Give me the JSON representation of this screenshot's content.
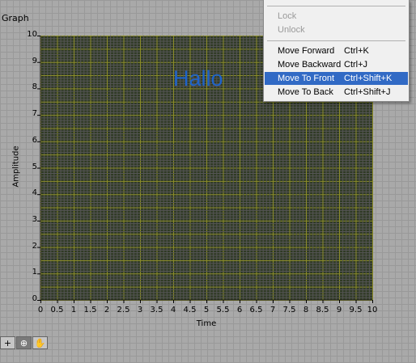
{
  "graph": {
    "title": "Graph",
    "ylabel": "Amplitude",
    "xlabel": "Time",
    "annotation": "Hallo",
    "y_ticks": [
      "10",
      "9",
      "8",
      "7",
      "6",
      "5",
      "4",
      "3",
      "2",
      "1",
      "0"
    ],
    "x_ticks": [
      "0",
      "0.5",
      "1",
      "1.5",
      "2",
      "2.5",
      "3",
      "3.5",
      "4",
      "4.5",
      "5",
      "5.5",
      "6",
      "6.5",
      "7",
      "7.5",
      "8",
      "8.5",
      "9",
      "9.5",
      "10"
    ]
  },
  "colors": {
    "plot_background": "#2f3a24",
    "major_grid": "#8c8c2a",
    "minor_grid": "#555555",
    "annotation": "#1f63c9",
    "menu_highlight": "#316ac5"
  },
  "palette": {
    "tools": [
      {
        "icon": "crosshair-icon",
        "glyph": "+"
      },
      {
        "icon": "zoom-icon",
        "glyph": "⊕"
      },
      {
        "icon": "hand-icon",
        "glyph": "✋"
      }
    ]
  },
  "context_menu": {
    "items": [
      {
        "label": "Lock",
        "shortcut": "",
        "disabled": true
      },
      {
        "label": "Unlock",
        "shortcut": "",
        "disabled": true
      },
      {
        "label": "Move Forward",
        "shortcut": "Ctrl+K",
        "disabled": false
      },
      {
        "label": "Move Backward",
        "shortcut": "Ctrl+J",
        "disabled": false
      },
      {
        "label": "Move To Front",
        "shortcut": "Ctrl+Shift+K",
        "disabled": false,
        "highlighted": true
      },
      {
        "label": "Move To Back",
        "shortcut": "Ctrl+Shift+J",
        "disabled": false
      }
    ]
  }
}
